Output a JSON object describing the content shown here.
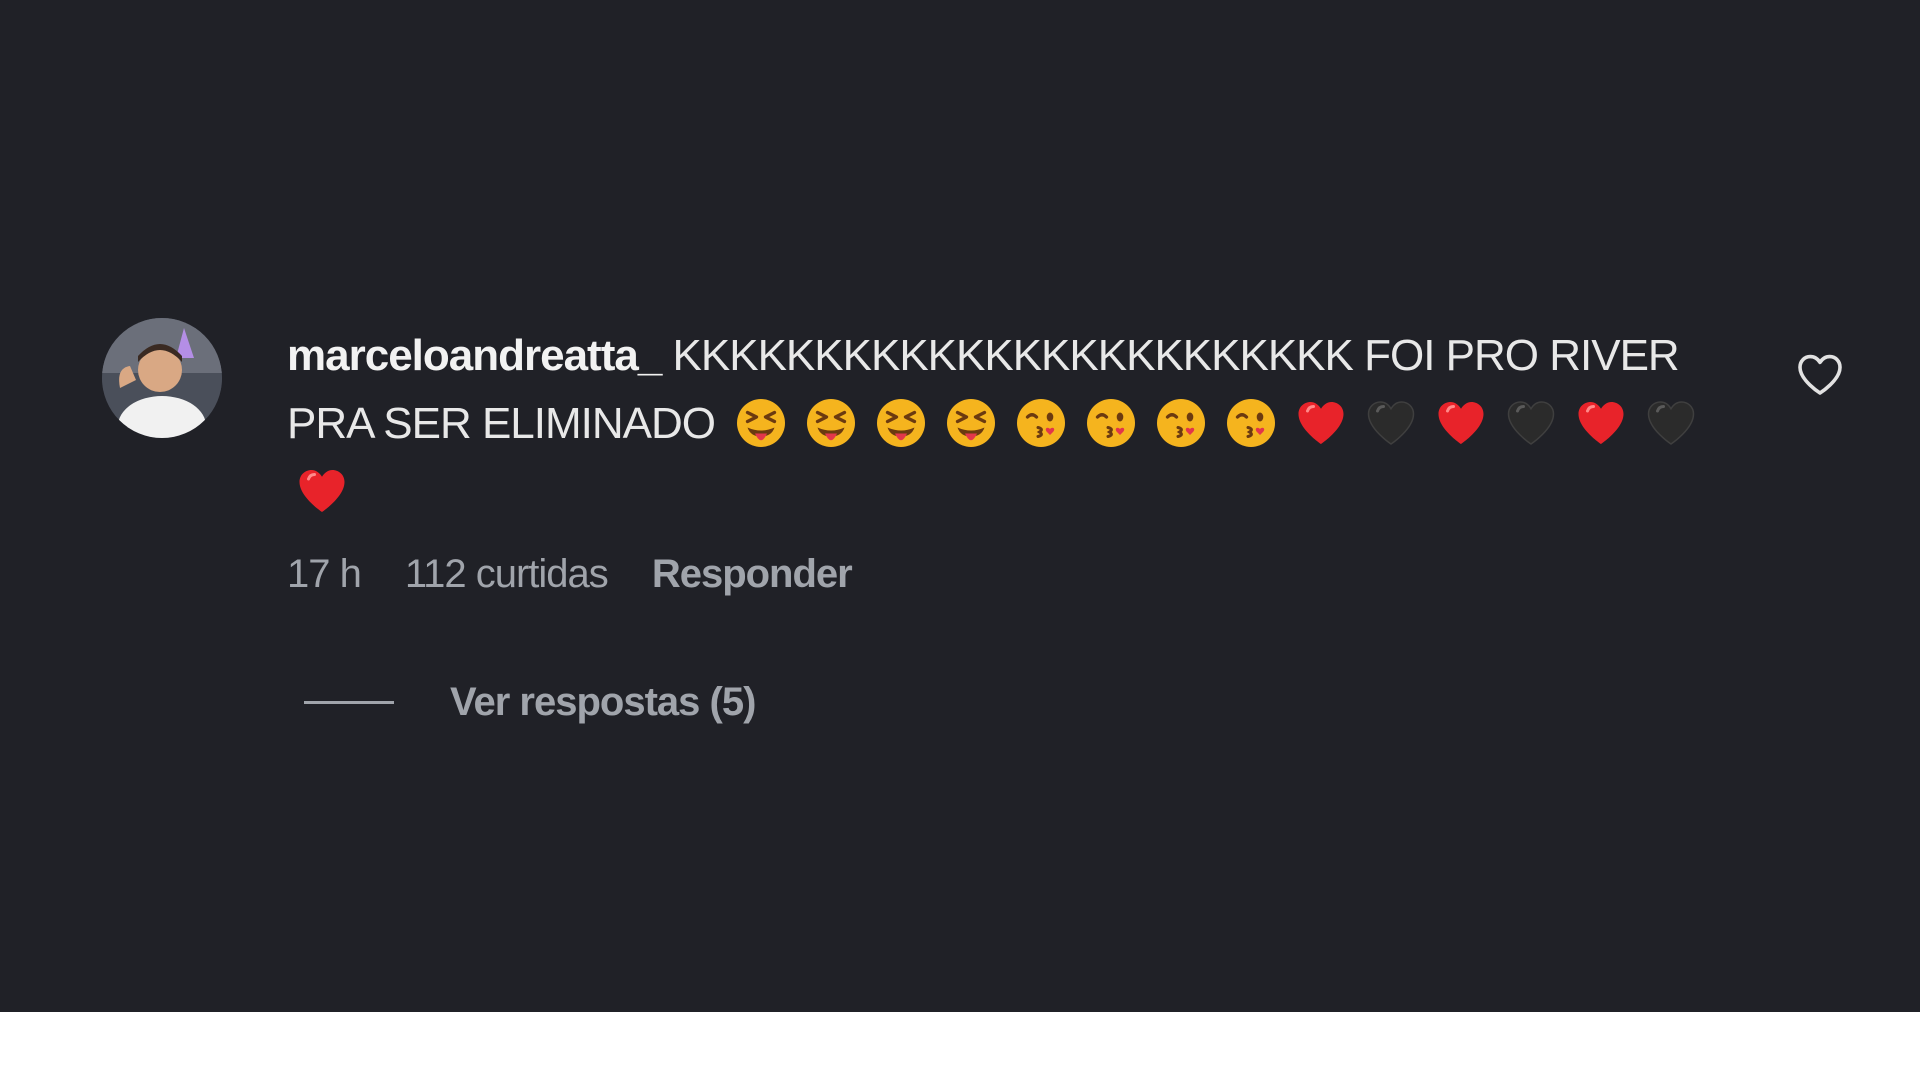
{
  "comment": {
    "username": "marceloandreatta_",
    "text": "KKKKKKKKKKKKKKKKKKKKKKKK FOI PRO RIVER PRA SER ELIMINADO",
    "emojis": [
      "tongue-squint-face",
      "tongue-squint-face",
      "tongue-squint-face",
      "tongue-squint-face",
      "kissing-wink-face",
      "kissing-wink-face",
      "kissing-wink-face",
      "kissing-wink-face",
      "red-heart",
      "black-heart",
      "red-heart",
      "black-heart",
      "red-heart",
      "black-heart",
      "red-heart"
    ],
    "time": "17 h",
    "likes": "112 curtidas",
    "reply_label": "Responder",
    "view_replies": "Ver respostas (5)",
    "like_icon": "heart-outline-icon"
  },
  "colors": {
    "background": "#202127",
    "text": "#e8e8e8",
    "muted": "#a0a4ab",
    "heart_red": "#e8232a",
    "heart_black": "#2b2b2b",
    "emoji_yellow": "#f5b41e"
  }
}
